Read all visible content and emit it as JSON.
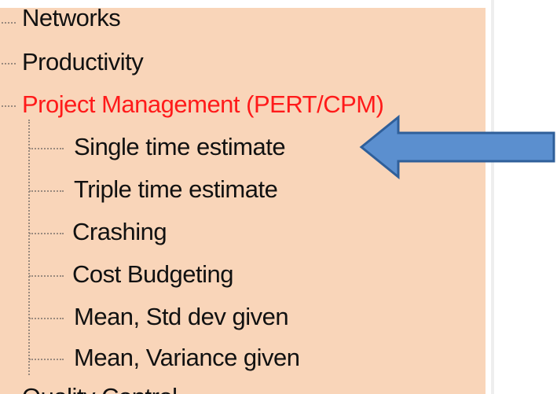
{
  "tree": {
    "top_items": [
      "Networks",
      "Productivity"
    ],
    "selected_item": "Project Management (PERT/CPM)",
    "children": [
      "Single time estimate",
      "Triple time estimate",
      "Crashing",
      "Cost Budgeting",
      "Mean, Std dev given",
      "Mean, Variance given"
    ],
    "bottom_item_partial": "Quality Control"
  },
  "colors": {
    "panel_background": "#f9d5b9",
    "selected_text": "#ff1a1a",
    "text": "#111111",
    "arrow_fill": "#5b8fcf",
    "arrow_stroke": "#2f5f9a"
  },
  "annotation": {
    "arrow_target": "Single time estimate"
  }
}
